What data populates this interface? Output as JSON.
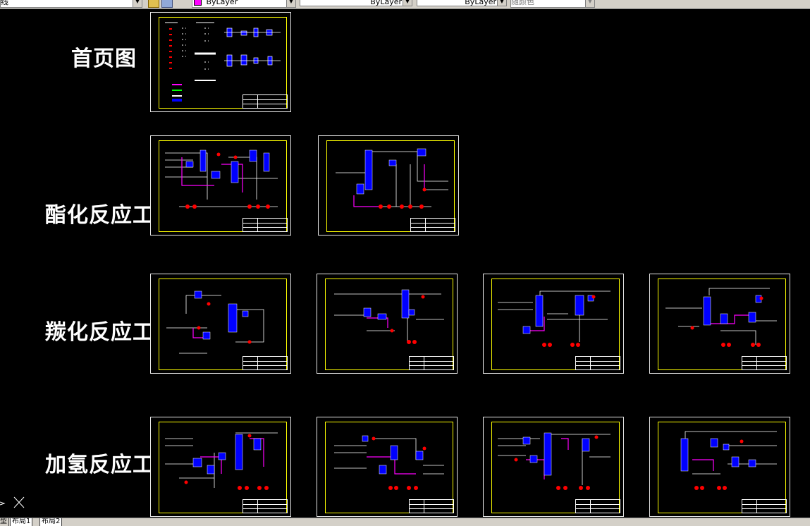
{
  "toolbar": {
    "layer_text": "线",
    "color_value": "ByLayer",
    "linetype_value": "ByLayer",
    "lineweight_value": "ByLayer",
    "plotstyle_value": "随颜色"
  },
  "sections": {
    "cover": "首页图",
    "esterification": "酯化反应工段",
    "carbonylation": "羰化反应工段",
    "hydrogenation": "加氢反应工段"
  },
  "layout_tabs": [
    "型",
    "布局1",
    "布局2"
  ],
  "colors": {
    "background": "#000000",
    "frame": "#ffff00",
    "equipment": "#0000ff",
    "pipe_process": "#ff00ff",
    "valve": "#ff0000",
    "line": "#ffffff"
  }
}
